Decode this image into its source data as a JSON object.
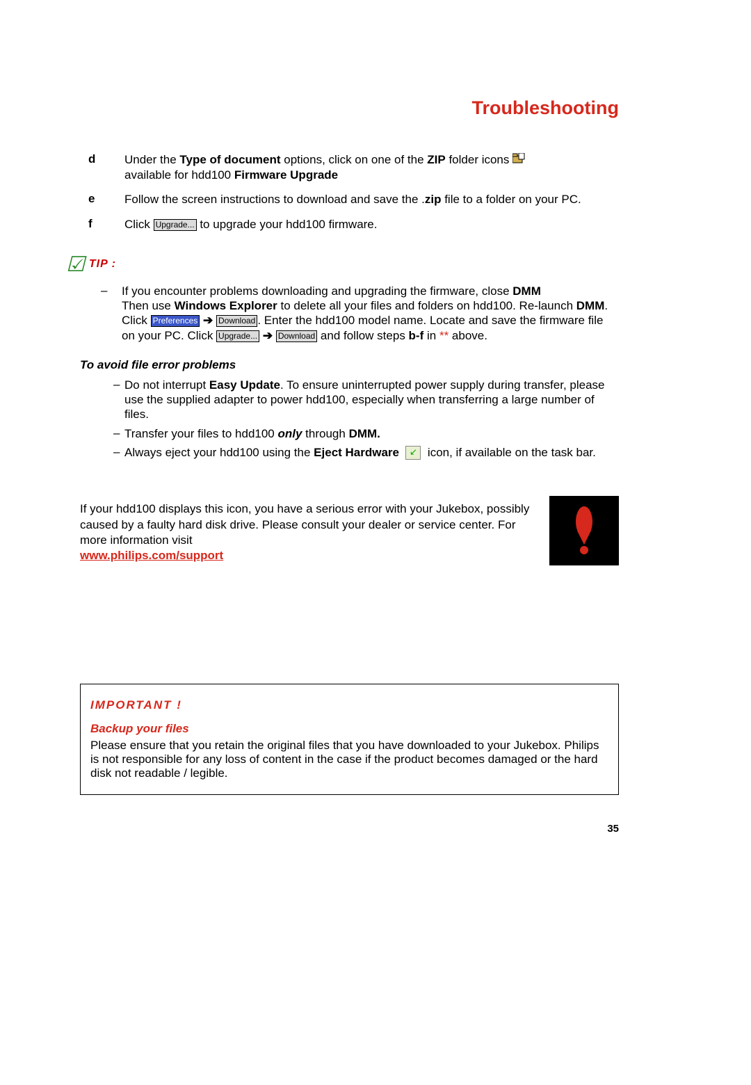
{
  "title": "Troubleshooting",
  "steps": {
    "d": {
      "letter": "d",
      "t1": "Under the ",
      "b1": "Type of document",
      "t2": " options, click on one of the ",
      "b2": "ZIP",
      "t3": " folder icons ",
      "t4": "available for hdd100 ",
      "b3": "Firmware Upgrade"
    },
    "e": {
      "letter": "e",
      "t1": "Follow the screen instructions to download and save the .",
      "b1": "zip",
      "t2": " file to a folder on your PC."
    },
    "f": {
      "letter": "f",
      "t1": "Click ",
      "btn": "Upgrade...",
      "t2": " to upgrade your hdd100 firmware."
    }
  },
  "tip": {
    "label": "TIP :",
    "line": {
      "t1": "If you encounter problems downloading and upgrading the firmware, close ",
      "b1": "DMM",
      "t2": "Then use ",
      "b2": "Windows Explorer",
      "t3": " to delete all your files and folders on hdd100. Re-launch ",
      "b3": "DMM",
      "t4": ". Click ",
      "btn1": "Preferences",
      "arrow1": "➔",
      "btn2": "Download",
      "t5": ". Enter the hdd100 model name. Locate and save the firmware file on your PC. Click ",
      "btn3": "Upgrade...",
      "arrow2": "➔",
      "btn4": "Download",
      "t6": " and follow steps ",
      "b4": "b-f",
      "t7": " in ",
      "star": "**",
      "t8": " above."
    }
  },
  "avoid": {
    "heading": "To avoid file error problems",
    "b1": {
      "t1": "Do not interrupt ",
      "b1": "Easy Update",
      "t2": ". To ensure uninterrupted power supply during transfer, please use the supplied adapter to power hdd100, especially when transferring a large number of files."
    },
    "b2": {
      "t1": "Transfer your files to hdd100 ",
      "i1": "only",
      "t2": " through ",
      "b1": "DMM."
    },
    "b3": {
      "t1": "Always eject your hdd100 using the ",
      "b1": "Eject Hardware",
      "t2": " icon, if available on the task bar."
    }
  },
  "error": {
    "text": "If your hdd100 displays this icon, you have a serious error with your Jukebox, possibly caused by a faulty hard disk drive. Please consult your dealer or service center. For more information visit ",
    "link": "www.philips.com/support"
  },
  "important": {
    "title": "IMPORTANT !",
    "sub": "Backup your files",
    "text": "Please ensure that you retain the original files that you have downloaded to your Jukebox. Philips is not responsible for any loss of content in the case if the product becomes damaged or the hard disk not readable / legible."
  },
  "pagenum": "35"
}
